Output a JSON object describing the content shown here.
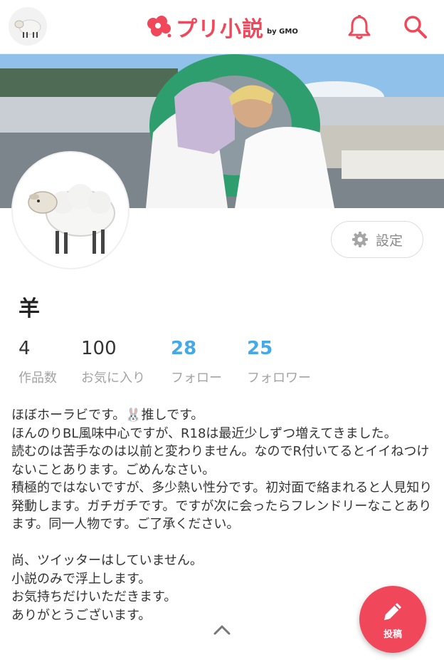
{
  "header": {
    "logo_text": "プリ小説",
    "logo_sub": "by GMO",
    "brand_color": "#f0485a",
    "icons": [
      "sheep-avatar-icon",
      "bell-icon",
      "search-icon"
    ]
  },
  "profile": {
    "name": "羊",
    "settings_label": "設定",
    "stats": [
      {
        "value": "4",
        "label": "作品数"
      },
      {
        "value": "100",
        "label": "お気に入り"
      },
      {
        "value": "28",
        "label": "フォロー"
      },
      {
        "value": "25",
        "label": "フォロワー"
      }
    ],
    "bio": "ほぼホーラビです。🐰推しです。\nほんのりBL風味中心ですが、R18は最近少しずつ増えてきました。\n読むのは苦手なのは以前と変わりません。なのでR付いてるとイイねつけないことあります。ごめんなさい。\n積極的ではないですが、多少熱い性分です。初対面で絡まれると人見知り発動します。ガチガチです。ですが次に会ったらフレンドリーなことあります。同一人物です。ご了承ください。\n\n尚、ツイッターはしていません。\n小説のみで浮上します。\nお気持ちだけいただきます。\nありがとうございます。"
  },
  "fab": {
    "label": "投稿"
  },
  "colors": {
    "accent": "#f0485a",
    "link_blue": "#45a9e8",
    "muted": "#a3a3a3"
  }
}
